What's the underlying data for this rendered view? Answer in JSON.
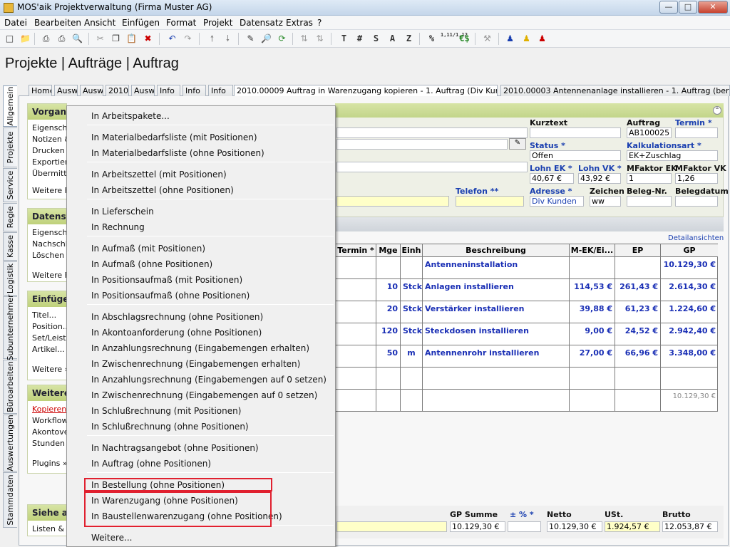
{
  "window": {
    "title": "MOS'aik Projektverwaltung (Firma Muster AG)",
    "min": "—",
    "max": "□",
    "close": "✕"
  },
  "menu": [
    "Datei",
    "Bearbeiten",
    "Ansicht",
    "Einfügen",
    "Format",
    "Projekt",
    "Datensatz",
    "Extras",
    "?"
  ],
  "toolbar_text": [
    "T",
    "#",
    "S",
    "A",
    "Z",
    "%",
    "1,11/1,12",
    "€$"
  ],
  "page_title": "Projekte | Aufträge | Auftrag",
  "vertical_tabs": [
    "Allgemein",
    "Projekte",
    "Service",
    "Regie",
    "Kasse",
    "Logistik",
    "Subunternehmer",
    "Büroarbeiten",
    "Auswertungen",
    "Stammdaten"
  ],
  "doc_tabs": {
    "short": [
      "Home",
      "Ausw",
      "Ausw",
      "2010",
      "Ausw",
      "Info",
      "Info",
      "Info"
    ],
    "active": "2010.00009 Auftrag in Warenzugang kopieren - 1. Auftrag (Div Kunden)",
    "other": "2010.00003 Antennenanlage installieren - 1. Auftrag (berger)",
    "close": "✕"
  },
  "sidebar": {
    "sections": [
      {
        "title": "Vorgang",
        "items": [
          "Eigenscha",
          "Notizen &",
          "Drucken &",
          "Exportiere",
          "Übermittel",
          "",
          "Weitere Fu"
        ]
      },
      {
        "title": "Datensat",
        "items": [
          "Eigenscha",
          "Nachschla",
          "Löschen",
          "",
          "Weitere Fu"
        ]
      },
      {
        "title": "Einfügen",
        "items": [
          "Titel...",
          "Position...",
          "Set/Leistu",
          "Artikel...",
          "",
          "Weitere »"
        ]
      },
      {
        "title": "Weitere",
        "items": [
          "Kopieren »",
          "Workflow",
          "Akontover",
          "Stunden u",
          "",
          "Plugins »"
        ]
      },
      {
        "title": "Siehe au",
        "items": [
          "Listen & St"
        ]
      }
    ]
  },
  "header_form": {
    "kurztext_label": "Kurztext",
    "auftrag_label": "Auftrag",
    "auftrag_value": "AB100025",
    "termin_label": "Termin *",
    "status_label": "Status *",
    "status_value": "Offen",
    "kalk_label": "Kalkulationsart *",
    "kalk_value": "EK+Zuschlag",
    "lohn_ek_label": "Lohn EK *",
    "lohn_ek_value": "40,67 €",
    "lohn_vk_label": "Lohn VK *",
    "lohn_vk_value": "43,92 €",
    "mf_ek_label": "MFaktor EK",
    "mf_ek_value": "1",
    "mf_vk_label": "MFaktor VK",
    "mf_vk_value": "1,26",
    "telefon_label": "Telefon **",
    "adresse_label": "Adresse *",
    "adresse_value": "Div Kunden",
    "zeichen_label": "Zeichen",
    "zeichen_value": "ww",
    "belegnr_label": "Beleg-Nr.",
    "belegdatum_label": "Belegdatum",
    "detail_link": "Detailansichten »"
  },
  "grid": {
    "headers": [
      "Termin *",
      "Mge",
      "Einh",
      "Beschreibung",
      "M-EK/Ei...",
      "EP",
      "GP"
    ],
    "rows": [
      {
        "mge": "",
        "einh": "",
        "desc": "Antenneninstallation",
        "mek": "",
        "ep": "",
        "gp": "10.129,30 €"
      },
      {
        "mge": "10",
        "einh": "Stck",
        "desc": "Anlagen installieren",
        "mek": "114,53 €",
        "ep": "261,43 €",
        "gp": "2.614,30 €"
      },
      {
        "mge": "20",
        "einh": "Stck",
        "desc": "Verstärker installieren",
        "mek": "39,88 €",
        "ep": "61,23 €",
        "gp": "1.224,60 €"
      },
      {
        "mge": "120",
        "einh": "Stck",
        "desc": "Steckdosen installieren",
        "mek": "9,00 €",
        "ep": "24,52 €",
        "gp": "2.942,40 €"
      },
      {
        "mge": "50",
        "einh": "m",
        "desc": "Antennenrohr installieren",
        "mek": "27,00 €",
        "ep": "66,96 €",
        "gp": "3.348,00 €"
      },
      {
        "mge": "",
        "einh": "",
        "desc": "",
        "mek": "",
        "ep": "",
        "gp": ""
      },
      {
        "mge": "",
        "einh": "",
        "desc": "",
        "mek": "",
        "ep": "",
        "gp": "10.129,30 €"
      }
    ]
  },
  "totals": {
    "gp_summe_label": "GP Summe",
    "pct_label": "± % *",
    "netto_label": "Netto",
    "ust_label": "USt.",
    "brutto_label": "Brutto",
    "gp_summe": "10.129,30 €",
    "netto": "10.129,30 €",
    "ust": "1.924,57 €",
    "brutto": "12.053,87 €"
  },
  "context_menu": {
    "items": [
      "In Arbeitspakete...",
      "In Materialbedarfsliste (mit Positionen)",
      "In Materialbedarfsliste (ohne Positionen)",
      "In Arbeitszettel (mit Positionen)",
      "In Arbeitszettel (ohne Positionen)",
      "In Lieferschein",
      "In Rechnung",
      "In Aufmaß (mit Positionen)",
      "In Aufmaß (ohne Positionen)",
      "In Positionsaufmaß (mit Positionen)",
      "In Positionsaufmaß (ohne Positionen)",
      "In Abschlagsrechnung (ohne Positionen)",
      "In Akontoanforderung (ohne Positionen)",
      "In Anzahlungsrechnung (Eingabemengen erhalten)",
      "In Zwischenrechnung (Eingabemengen erhalten)",
      "In Anzahlungsrechnung (Eingabemengen auf 0 setzen)",
      "In Zwischenrechnung (Eingabemengen auf 0 setzen)",
      "In Schlußrechnung (mit Positionen)",
      "In Schlußrechnung (ohne Positionen)",
      "In Nachtragsangebot (ohne Positionen)",
      "In Auftrag (ohne Positionen)",
      "In Bestellung (ohne Positionen)",
      "In Warenzugang (ohne Positionen)",
      "In Baustellenwarenzugang (ohne Positionen)",
      "Weitere..."
    ]
  },
  "colors": {
    "highlight_red": "#e0202f",
    "link_blue": "#1a3fb0",
    "panel_green": "#c2d58a"
  }
}
